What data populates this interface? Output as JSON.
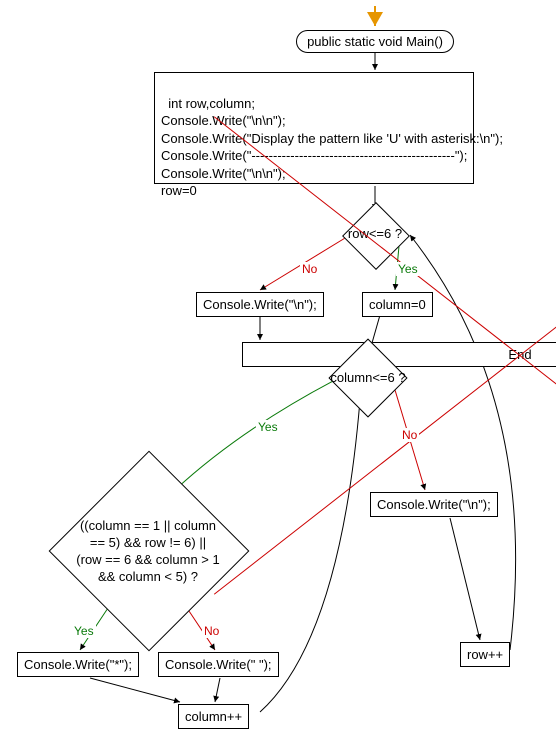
{
  "chart_data": {
    "type": "flowchart",
    "nodes": [
      {
        "id": "start",
        "shape": "entry-arrow"
      },
      {
        "id": "main",
        "shape": "rounded",
        "text": "public static void Main()"
      },
      {
        "id": "init",
        "shape": "rect",
        "text": "int row,column;\nConsole.Write(\"\\n\\n\");\nConsole.Write(\"Display the pattern like 'U' with asterisk:\\n\");\nConsole.Write(\"-----------------------------------------------\");\nConsole.Write(\"\\n\\n\");\nrow=0"
      },
      {
        "id": "rowCond",
        "shape": "diamond",
        "text": "row<=6 ?"
      },
      {
        "id": "writeNL1",
        "shape": "rect",
        "text": "Console.Write(\"\\n\");"
      },
      {
        "id": "end",
        "shape": "end",
        "text": "End"
      },
      {
        "id": "colZero",
        "shape": "rect",
        "text": "column=0"
      },
      {
        "id": "colCond",
        "shape": "diamond",
        "text": "column<=6 ?"
      },
      {
        "id": "printCond",
        "shape": "diamond",
        "text": "((column == 1 || column == 5) && row != 6) || (row == 6 && column > 1 && column < 5) ?"
      },
      {
        "id": "writeStar",
        "shape": "rect",
        "text": "Console.Write(\"*\");"
      },
      {
        "id": "writeSpace",
        "shape": "rect",
        "text": "Console.Write(\" \");"
      },
      {
        "id": "colInc",
        "shape": "rect",
        "text": "column++"
      },
      {
        "id": "writeNL2",
        "shape": "rect",
        "text": "Console.Write(\"\\n\");"
      },
      {
        "id": "rowInc",
        "shape": "rect",
        "text": "row++"
      }
    ],
    "edges": [
      {
        "from": "start",
        "to": "main"
      },
      {
        "from": "main",
        "to": "init"
      },
      {
        "from": "init",
        "to": "rowCond"
      },
      {
        "from": "rowCond",
        "to": "writeNL1",
        "label": "No"
      },
      {
        "from": "writeNL1",
        "to": "end"
      },
      {
        "from": "rowCond",
        "to": "colZero",
        "label": "Yes"
      },
      {
        "from": "colZero",
        "to": "colCond"
      },
      {
        "from": "colCond",
        "to": "printCond",
        "label": "Yes"
      },
      {
        "from": "printCond",
        "to": "writeStar",
        "label": "Yes"
      },
      {
        "from": "printCond",
        "to": "writeSpace",
        "label": "No"
      },
      {
        "from": "writeStar",
        "to": "colInc"
      },
      {
        "from": "writeSpace",
        "to": "colInc"
      },
      {
        "from": "colInc",
        "to": "colCond"
      },
      {
        "from": "colCond",
        "to": "writeNL2",
        "label": "No"
      },
      {
        "from": "writeNL2",
        "to": "rowInc"
      },
      {
        "from": "rowInc",
        "to": "rowCond"
      }
    ]
  },
  "labels": {
    "yes": "Yes",
    "no": "No"
  },
  "nodes": {
    "main": "public static void Main()",
    "init": "int row,column;\nConsole.Write(\"\\n\\n\");\nConsole.Write(\"Display the pattern like 'U' with asterisk:\\n\");\nConsole.Write(\"-----------------------------------------------\");\nConsole.Write(\"\\n\\n\");\nrow=0",
    "rowCond": "row<=6 ?",
    "writeNL1": "Console.Write(\"\\n\");",
    "end": "End",
    "colZero": "column=0",
    "colCond": "column<=6 ?",
    "printCond_l1": "((column == 1 || column",
    "printCond_l2": "== 5) && row != 6) ||",
    "printCond_l3": "(row == 6 && column > 1",
    "printCond_l4": "&& column < 5) ?",
    "writeStar": "Console.Write(\"*\");",
    "writeSpace": "Console.Write(\" \");",
    "colInc": "column++",
    "writeNL2": "Console.Write(\"\\n\");",
    "rowInc": "row++"
  }
}
